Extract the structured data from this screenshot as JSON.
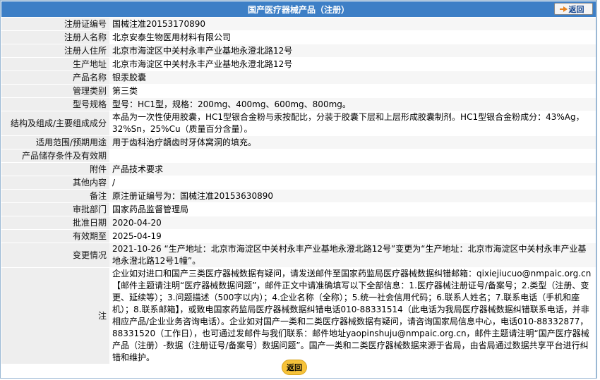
{
  "header": {
    "title": "国产医疗器械产品（注册）",
    "back_label": "返回"
  },
  "rows": [
    {
      "label": "注册证编号",
      "value": "国械注准20153170890"
    },
    {
      "label": "注册人名称",
      "value": "北京安泰生物医用材料有限公司"
    },
    {
      "label": "注册人住所",
      "value": "北京市海淀区中关村永丰产业基地永澄北路12号"
    },
    {
      "label": "生产地址",
      "value": "北京市海淀区中关村永丰产业基地永澄北路12号"
    },
    {
      "label": "产品名称",
      "value": "银汞胶囊"
    },
    {
      "label": "管理类别",
      "value": "第三类"
    },
    {
      "label": "型号规格",
      "value": "型号：HC1型，规格：200mg、400mg、600mg、800mg。"
    },
    {
      "label": "结构及组成/主要组成成分",
      "value": "本品为一次性使用胶囊，HC1型银合金粉与汞按配比，分装于胶囊下层和上层形成胶囊制剂。HC1型银合金粉成分：43%Ag，32%Sn，25%Cu（质量百分含量）。"
    },
    {
      "label": "适用范围/预期用途",
      "value": "用于齿科治疗龋齿时牙体窝洞的填充。"
    },
    {
      "label": "产品储存条件及有效期",
      "value": ""
    },
    {
      "label": "附件",
      "value": "产品技术要求"
    },
    {
      "label": "其他内容",
      "value": "/"
    },
    {
      "label": "备注",
      "value": "原注册证编号为：国械注准20153630890"
    },
    {
      "label": "审批部门",
      "value": "国家药品监督管理局"
    },
    {
      "label": "批准日期",
      "value": "2020-04-20"
    },
    {
      "label": "有效期至",
      "value": "2025-04-19"
    },
    {
      "label": "变更情况",
      "value": "2021-10-26 “生产地址：北京市海淀区中关村永丰产业基地永澄北路12号”变更为“生产地址：北京市海淀区中关村永丰产业基地永澄北路12号1幢”。"
    },
    {
      "label": "注",
      "value": "企业如对进口和国产三类医疗器械数据有疑问，请发送邮件至国家药监局医疗器械数据纠错邮箱：qixiejiucuo@nmpaic.org.cn【邮件主题请注明“医疗器械数据问题”，邮件正文中请准确填写以下全部信息：1.医疗器械注册证号/备案号；2.类型（注册、变更、延续等）；3.问题描述（500字以内）；4.企业名称（全称）；5.统一社会信用代码；6.联系人姓名；7.联系电话（手机和座机）；8.联系邮箱】，或致电国家药监局医疗器械数据纠错电话010-88331514（此电话为我局医疗器械数据纠错联系电话，并非相应产品/企业业务咨询电话）。企业如对国产一类和二类医疗器械数据有疑问，请咨询国家局信息中心，电话010-88332877，88331520（工作日），也可通过发邮件与我们联系：邮件地址yaopinshuju@nmpaic.org.cn，邮件主题请注明“国产医疗器械产品（注册）-数据（注册证号/备案号）数据问题”。国产一类和二类医疗器械数据来源于省局，由省局通过数据共享平台进行纠错和维护。"
    }
  ],
  "footer": {
    "back_label": "返回"
  }
}
